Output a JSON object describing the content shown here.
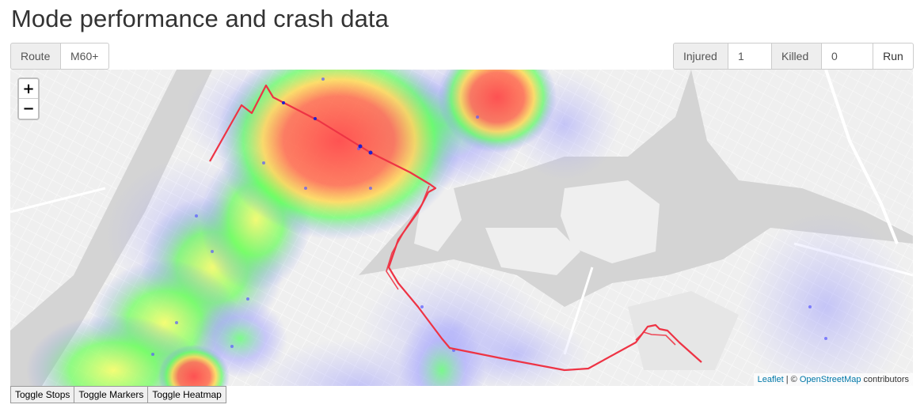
{
  "page": {
    "title": "Mode performance and crash data"
  },
  "route": {
    "label": "Route",
    "value": "M60+"
  },
  "filters": {
    "injured_label": "Injured",
    "injured_value": "1",
    "killed_label": "Killed",
    "killed_value": "0",
    "run_label": "Run"
  },
  "map": {
    "zoom_in": "+",
    "zoom_out": "−",
    "attribution": {
      "leaflet": "Leaflet",
      "separator": " | © ",
      "osm": "OpenStreetMap",
      "suffix": " contributors"
    },
    "colors": {
      "water": "#d4d4d4",
      "land": "#f2f2f2",
      "route_line": "#ee3344",
      "heat_low": "#8080ff",
      "heat_mid": "#40ff40",
      "heat_high": "#ff4040"
    }
  },
  "toggles": {
    "stops": "Toggle Stops",
    "markers": "Toggle Markers",
    "heatmap": "Toggle Heatmap"
  }
}
